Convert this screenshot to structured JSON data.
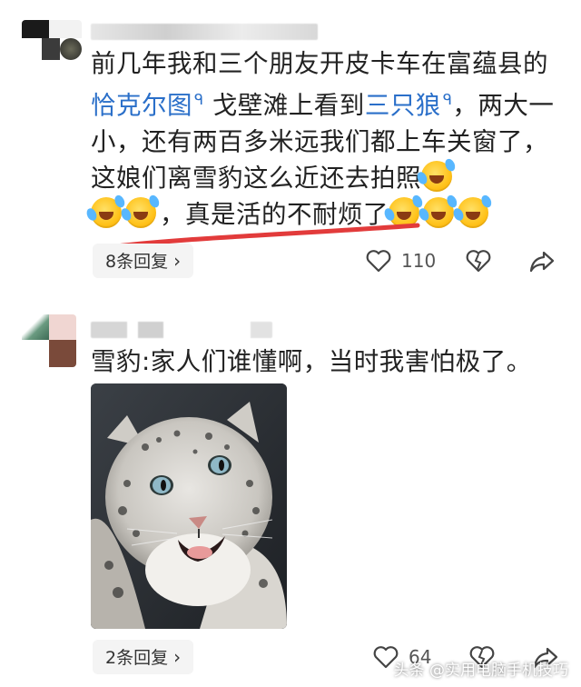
{
  "comment1": {
    "text_a": "前几年我和三个朋友开皮卡车在富蕴县的",
    "link1": "恰克尔图",
    "text_b": "戈壁滩上看到",
    "link2": "三只狼",
    "text_c": "，两大一小，还有两百多米远我们都上车关窗了，这娘们离雪豹这么近还去拍照",
    "text_d": "，真是活的不耐烦了",
    "reply_label": "8条回复",
    "reply_chevron": "›",
    "like_count": "110"
  },
  "comment2": {
    "text": "雪豹:家人们谁懂啊，当时我害怕极了。",
    "reply_label": "2条回复",
    "reply_chevron": "›",
    "like_count": "64"
  },
  "watermark": "头条 @实用电脑手机技巧",
  "colors": {
    "link": "#2a6fc9",
    "underline": "#e23b3b"
  }
}
